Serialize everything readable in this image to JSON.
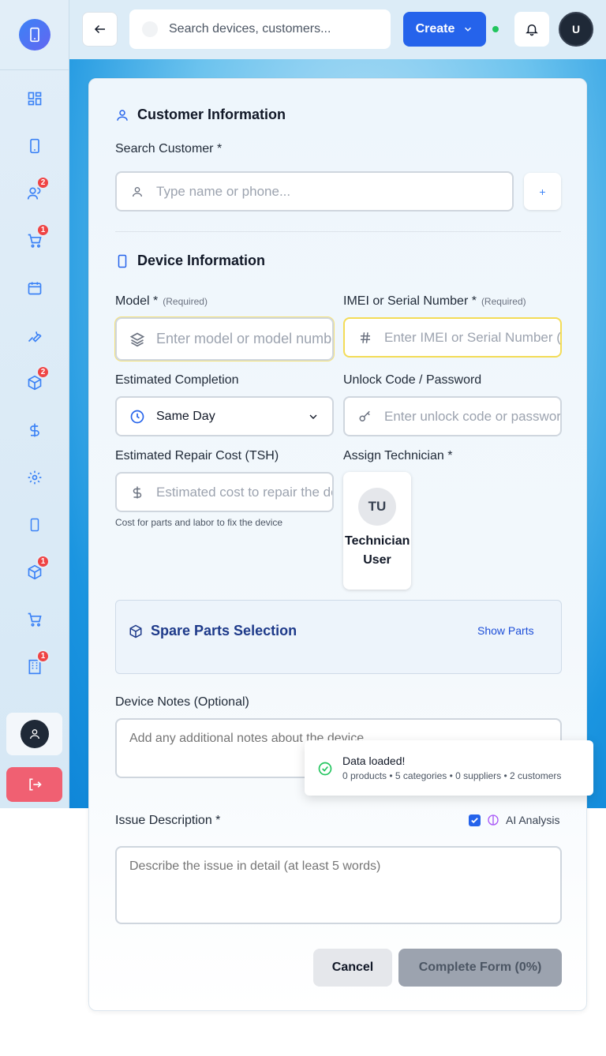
{
  "topbar": {
    "search_placeholder": "Search devices, customers...",
    "create_label": "Create",
    "avatar_initial": "U"
  },
  "sidebar": {
    "badges": {
      "customers": "2",
      "cart": "1",
      "inventory": "2",
      "inventory2": "1",
      "building": "1"
    }
  },
  "customer": {
    "section_title": "Customer Information",
    "search_label": "Search Customer *",
    "search_placeholder": "Type name or phone...",
    "add_label": "+"
  },
  "device": {
    "section_title": "Device Information",
    "model_label": "Model *",
    "model_required": "(Required)",
    "model_placeholder": "Enter model or model number",
    "imei_label": "IMEI or Serial Number *",
    "imei_required": "(Required)",
    "imei_placeholder": "Enter IMEI or Serial Number (",
    "completion_label": "Estimated Completion",
    "completion_value": "Same Day",
    "unlock_label": "Unlock Code / Password",
    "unlock_placeholder": "Enter unlock code or password",
    "cost_label": "Estimated Repair Cost (TSH)",
    "cost_placeholder": "Estimated cost to repair the device",
    "cost_hint": "Cost for parts and labor to fix the device",
    "tech_label": "Assign Technician *",
    "tech_initials": "TU",
    "tech_name": "Technician User"
  },
  "spare_parts": {
    "title": "Spare Parts Selection",
    "show_label": "Show Parts"
  },
  "notes": {
    "label": "Device Notes (Optional)",
    "placeholder": "Add any additional notes about the device..."
  },
  "issue": {
    "label": "Issue Description *",
    "ai_label": "AI Analysis",
    "placeholder": "Describe the issue in detail (at least 5 words)"
  },
  "actions": {
    "cancel_label": "Cancel",
    "complete_label": "Complete Form (0%)"
  },
  "toast": {
    "title": "Data loaded!",
    "detail": "0 products • 5 categories • 0 suppliers • 2 customers"
  }
}
